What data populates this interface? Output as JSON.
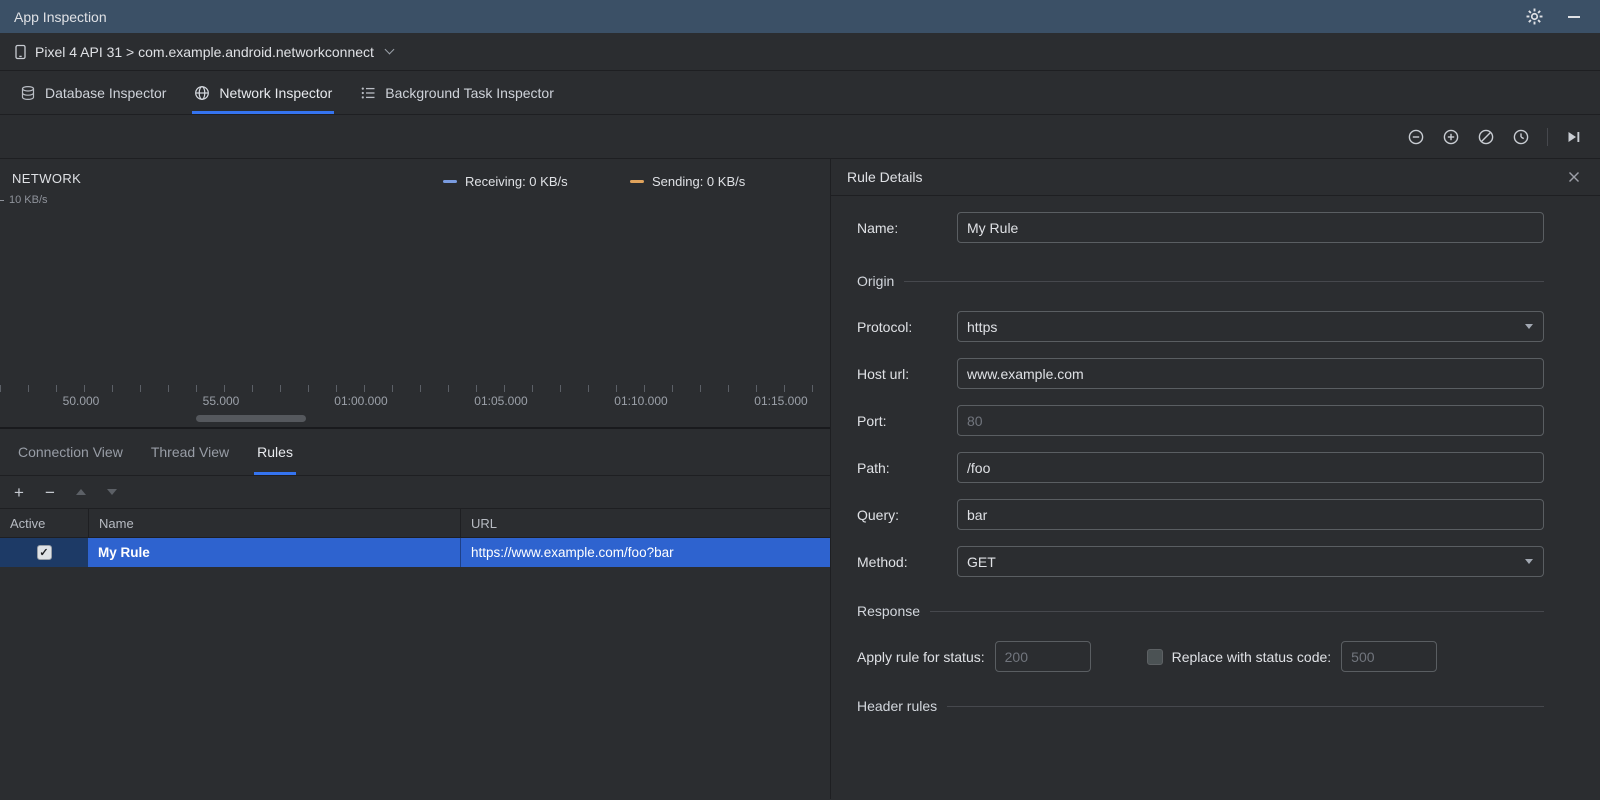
{
  "colors": {
    "accent": "#3574f0",
    "titlebar": "#3b5066",
    "selection_row": "#2e63cf",
    "receiving": "#7a9ce0",
    "sending": "#e0a35c"
  },
  "title_bar": {
    "title": "App Inspection"
  },
  "device_bar": {
    "selector_label": "Pixel 4 API 31 > com.example.android.networkconnect"
  },
  "inspector_tabs": {
    "active": "Network Inspector",
    "items": [
      {
        "label": "Database Inspector"
      },
      {
        "label": "Network Inspector"
      },
      {
        "label": "Background Task Inspector"
      }
    ]
  },
  "main_toolbar": {
    "icons": [
      "zoom-out",
      "zoom-in",
      "reset-zoom",
      "clock",
      "go-to-live"
    ]
  },
  "network_panel": {
    "title": "NETWORK",
    "y_axis_label": "10 KB/s",
    "legend": [
      {
        "label": "Receiving: 0 KB/s",
        "color": "#7a9ce0"
      },
      {
        "label": "Sending: 0 KB/s",
        "color": "#e0a35c"
      }
    ],
    "time_ticks": [
      "50.000",
      "55.000",
      "01:00.000",
      "01:05.000",
      "01:10.000",
      "01:15.000"
    ],
    "chart_data": {
      "type": "line",
      "x_ticks": [
        "50.000",
        "55.000",
        "01:00.000",
        "01:05.000",
        "01:10.000",
        "01:15.000"
      ],
      "ylim": [
        0,
        10
      ],
      "y_unit": "KB/s",
      "series": [
        {
          "name": "Receiving",
          "values": [
            0,
            0,
            0,
            0,
            0,
            0
          ]
        },
        {
          "name": "Sending",
          "values": [
            0,
            0,
            0,
            0,
            0,
            0
          ]
        }
      ]
    }
  },
  "view_tabs": {
    "active": "Rules",
    "items": [
      {
        "label": "Connection View"
      },
      {
        "label": "Thread View"
      },
      {
        "label": "Rules"
      }
    ]
  },
  "rules_table": {
    "columns": [
      "Active",
      "Name",
      "URL"
    ],
    "rows": [
      {
        "active": true,
        "check_glyph": "✓",
        "name": "My Rule",
        "url": "https://www.example.com/foo?bar"
      }
    ]
  },
  "rule_details": {
    "title": "Rule Details",
    "name_label": "Name:",
    "name_value": "My Rule",
    "origin_section": "Origin",
    "protocol_label": "Protocol:",
    "protocol_value": "https",
    "host_label": "Host url:",
    "host_value": "www.example.com",
    "port_label": "Port:",
    "port_placeholder": "80",
    "path_label": "Path:",
    "path_value": "/foo",
    "query_label": "Query:",
    "query_value": "bar",
    "method_label": "Method:",
    "method_value": "GET",
    "response_section": "Response",
    "status_label": "Apply rule for status:",
    "status_placeholder": "200",
    "replace_label": "Replace with status code:",
    "replace_placeholder": "500",
    "replace_checked": false,
    "header_rules_section": "Header rules"
  }
}
